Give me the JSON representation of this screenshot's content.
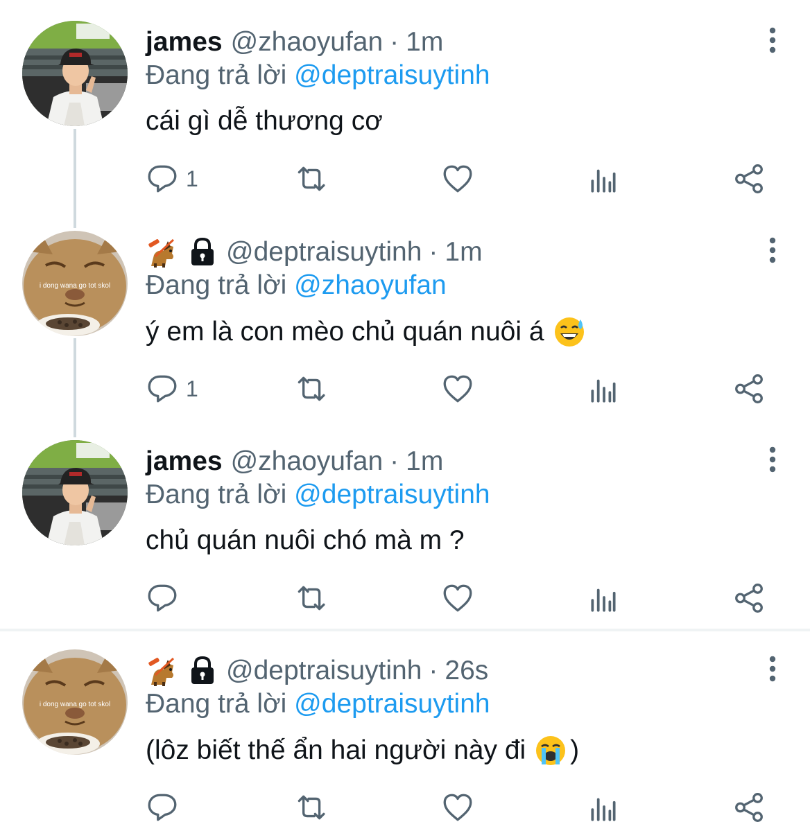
{
  "colors": {
    "text": "#0f1419",
    "secondary": "#536471",
    "link": "#1d9bf0",
    "thread_line": "#cfd9de",
    "divider": "#eff3f4"
  },
  "tweets": [
    {
      "name": "james",
      "handle": "@zhaoyufan",
      "separator": "·",
      "time": "1m",
      "reply_prefix": "Đang trả lời",
      "reply_to": "@deptraisuytinh",
      "text": "cái gì dễ thương cơ",
      "reply_count": "1",
      "avatar": "man-in-stadium-avatar",
      "badges": [],
      "emoji": null
    },
    {
      "name": "",
      "handle": "@deptraisuytinh",
      "separator": "·",
      "time": "1m",
      "reply_prefix": "Đang trả lời",
      "reply_to": "@zhaoyufan",
      "text": "ý em là con mèo chủ quán nuôi á",
      "reply_count": "1",
      "avatar": "cat-meme-avatar",
      "avatar_caption": "i dong wana go tot skol",
      "badges": [
        "service-dog-emoji",
        "lock-icon"
      ],
      "emoji": "grinning-sweat-emoji"
    },
    {
      "name": "james",
      "handle": "@zhaoyufan",
      "separator": "·",
      "time": "1m",
      "reply_prefix": "Đang trả lời",
      "reply_to": "@deptraisuytinh",
      "text": "chủ quán nuôi chó mà m ?",
      "reply_count": "",
      "avatar": "man-in-stadium-avatar",
      "badges": [],
      "emoji": null
    },
    {
      "name": "",
      "handle": "@deptraisuytinh",
      "separator": "·",
      "time": "26s",
      "reply_prefix": "Đang trả lời",
      "reply_to": "@deptraisuytinh",
      "text": "(lôz biết thế ẩn hai người này đi",
      "text_suffix": ")",
      "reply_count": "",
      "avatar": "cat-meme-avatar",
      "avatar_caption": "i dong wana go tot skol",
      "badges": [
        "service-dog-emoji",
        "lock-icon"
      ],
      "emoji": "loudly-crying-emoji"
    }
  ],
  "action_icons": [
    "reply-icon",
    "retweet-icon",
    "like-icon",
    "views-icon",
    "share-icon"
  ]
}
